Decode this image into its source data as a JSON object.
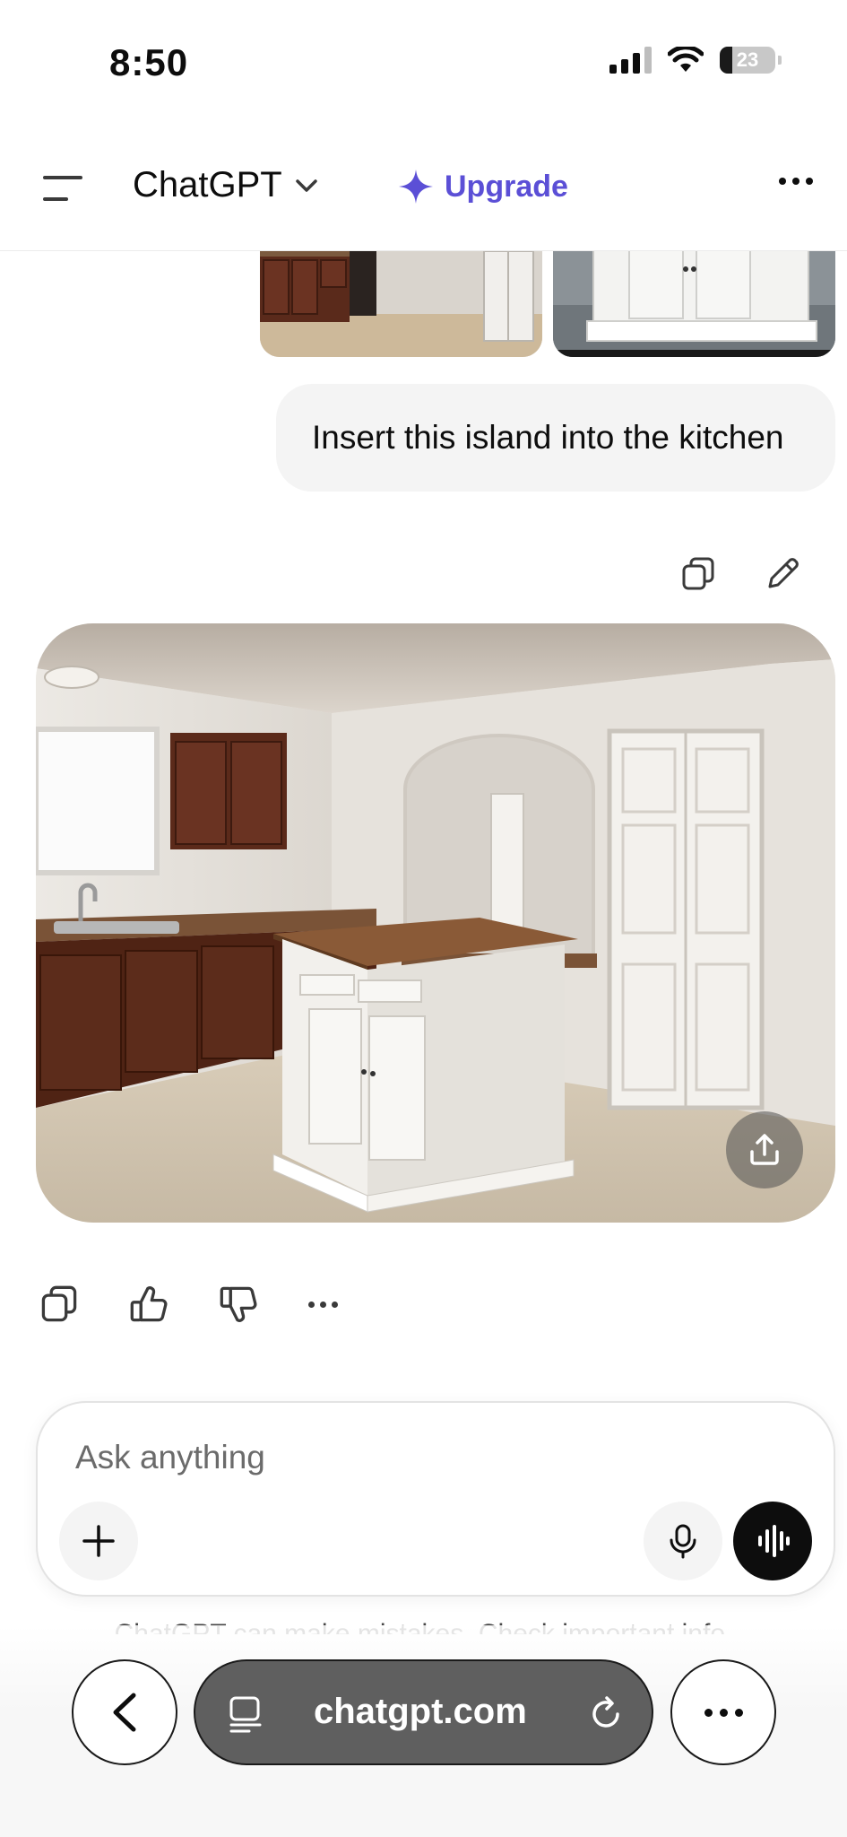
{
  "status_bar": {
    "time": "8:50",
    "battery": "23",
    "battery_level": 0.23
  },
  "header": {
    "model_name": "ChatGPT",
    "upgrade_label": "Upgrade",
    "accent_color": "#5b4fd6"
  },
  "chat": {
    "user_message": "Insert this island into the kitchen",
    "icons": {
      "copy": "copy-icon",
      "edit": "pencil-icon",
      "share": "share-upload-icon",
      "thumbs_up": "thumbs-up-icon",
      "thumbs_down": "thumbs-down-icon",
      "more": "more-dots-icon"
    }
  },
  "composer": {
    "placeholder": "Ask anything"
  },
  "disclaimer": "ChatGPT can make mistakes. Check important info.",
  "browser": {
    "url": "chatgpt.com"
  }
}
